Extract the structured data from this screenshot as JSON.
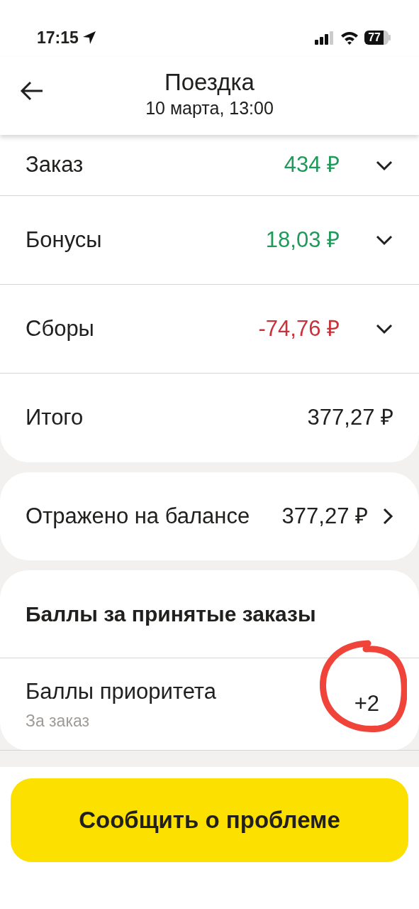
{
  "status_bar": {
    "time": "17:15",
    "battery": "77"
  },
  "header": {
    "title": "Поездка",
    "subtitle": "10 марта, 13:00"
  },
  "summary": [
    {
      "label": "Заказ",
      "amount": "434 ₽",
      "color": "#1f9a5a",
      "kind": "expandable"
    },
    {
      "label": "Бонусы",
      "amount": "18,03 ₽",
      "color": "#1f9a5a",
      "kind": "expandable"
    },
    {
      "label": "Сборы",
      "amount": "-74,76 ₽",
      "color": "#c8333b",
      "kind": "expandable"
    },
    {
      "label": "Итого",
      "amount": "377,27 ₽",
      "color": "#21201f",
      "kind": "total"
    }
  ],
  "balance": {
    "label": "Отражено на балансе",
    "amount": "377,27 ₽"
  },
  "points": {
    "title": "Баллы за принятые заказы",
    "items": [
      {
        "label": "Баллы приоритета",
        "note": "За заказ",
        "value": "+2",
        "circled": true
      }
    ]
  },
  "button": "Сообщить о проблеме"
}
